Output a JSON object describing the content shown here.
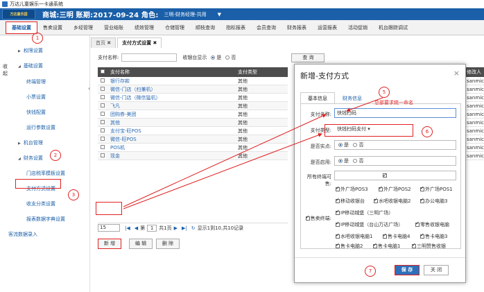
{
  "window": {
    "title": "万达儿童娱乐一卡通系统"
  },
  "header": {
    "logo_text": "万达童乐园",
    "info": "商城:三明  账期:2017-09-24  角色:",
    "role": "三明-财务经理-共用",
    "dropdown": "▼"
  },
  "menu": [
    "基础设置",
    "售卖设置",
    "乡经管理",
    "营业结账",
    "绩效管理",
    "仓储管理",
    "顺枝查询",
    "指标报表",
    "会员查询",
    "财务报表",
    "运营报表",
    "活动促销",
    "机台跟踪调试"
  ],
  "sidebar": {
    "vertical_label": "收起",
    "items": [
      {
        "label": "权限设置",
        "type": "group"
      },
      {
        "label": "基础设置",
        "type": "group"
      },
      {
        "label": "终端管理",
        "type": "sub"
      },
      {
        "label": "小票设置",
        "type": "sub"
      },
      {
        "label": "快钱配置",
        "type": "sub"
      },
      {
        "label": "运行参数设置",
        "type": "sub"
      },
      {
        "label": "机台管理",
        "type": "group"
      },
      {
        "label": "财务设置",
        "type": "group"
      },
      {
        "label": "门店税率模板设置",
        "type": "sub"
      },
      {
        "label": "支付方式设置",
        "type": "sub"
      },
      {
        "label": "收支分类设置",
        "type": "sub"
      },
      {
        "label": "报表数据字典设置",
        "type": "sub"
      },
      {
        "label": "客流数据录入",
        "type": "root"
      }
    ]
  },
  "tabs": [
    {
      "label": "首页 ✖"
    },
    {
      "label": "支付方式设置 ✖"
    }
  ],
  "search": {
    "name_label": "支付名称:",
    "show_label": "收银台显示",
    "yes": "是",
    "no": "否",
    "query_btn": "查 询"
  },
  "grid": {
    "headers": [
      "支付名称",
      "支付类型"
    ],
    "rows": [
      [
        "银行存款",
        "其他"
      ],
      [
        "微信-门店（扫兼机）",
        "其他"
      ],
      [
        "微信-门店（微信猛机）",
        "其他"
      ],
      [
        "飞凡",
        "其他"
      ],
      [
        "团购券-美团",
        "其他"
      ],
      [
        "其他",
        "其他"
      ],
      [
        "支付宝-旺POS",
        "其他"
      ],
      [
        "微信-旺POS",
        "其他"
      ],
      [
        "POS机",
        "其他"
      ],
      [
        "现金",
        "其他"
      ]
    ]
  },
  "pager": {
    "page_size": "15",
    "page_label": "第",
    "page_num": "1",
    "total_pages": "共1页",
    "summary": "显示1到10,共10记录"
  },
  "actions": {
    "add": "新 增",
    "edit": "编 辑",
    "delete": "删 除"
  },
  "right_grid": {
    "header": "修改人",
    "rows": [
      "sanmic",
      "sanmic",
      "sanmic",
      "sanmic",
      "sanmic",
      "sanmic",
      "sanmic",
      "sanmic",
      "sanmic",
      "sanmic"
    ]
  },
  "modal": {
    "title": "新增-支付方式",
    "close": "×",
    "tab_basic": "基本信息",
    "tab_finance": "财务信息",
    "name_label": "支付名称:",
    "name_value": "快钱扫码",
    "type_label": "支付类型:",
    "type_value": "快钱扫码支付",
    "is_sell_label": "是否实点:",
    "is_enabled_label": "是否启用:",
    "all_terminal_label": "所有终端可售:",
    "sell_terminal_label": "售卖终端:",
    "yes": "是",
    "no": "否",
    "terminals": [
      "外广场POS3",
      "外广场POS2",
      "外广场POS1",
      "移动收银台",
      "水吧收银电脑2",
      "办公电脑3",
      "IP移动城堡（三明广场）",
      "IP移动城堡（台山万达广场）",
      "零售收银电脑",
      "水吧收银电脑1",
      "售卡电脑4",
      "售卡电脑3",
      "售卡电脑2",
      "售卡电脑1",
      "三明赞售收银"
    ],
    "save": "保 存",
    "close_btn": "关 闭"
  },
  "annotations": {
    "note": "总部要求统一命名",
    "c1": "1",
    "c2": "2",
    "c3": "3",
    "c5": "5",
    "c6": "6",
    "c7": "7"
  },
  "colors": {
    "brand": "#1a5fa8",
    "annotation": "#e02020",
    "grid_header": "#4d4d4d"
  }
}
